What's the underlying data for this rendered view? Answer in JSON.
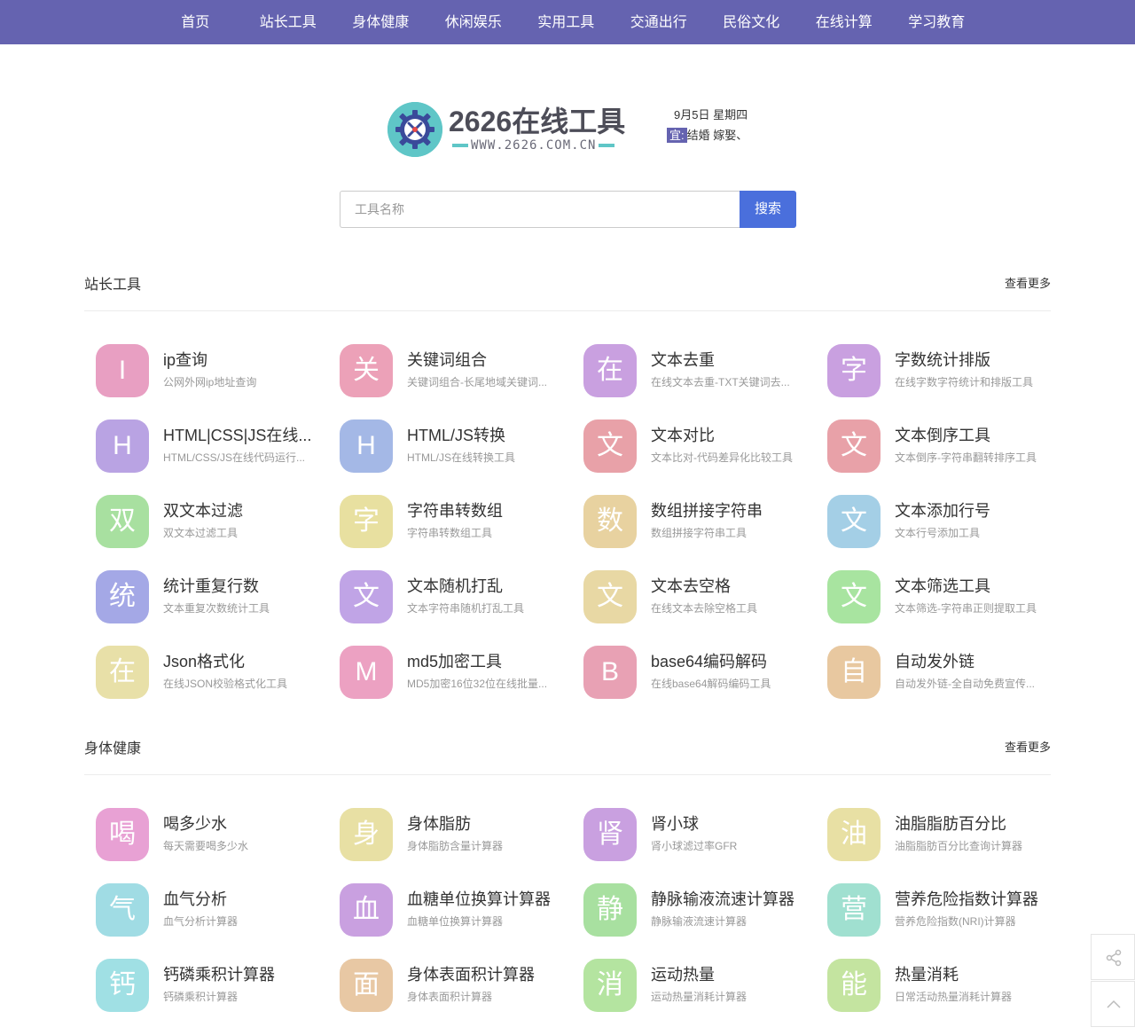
{
  "nav": [
    "首页",
    "站长工具",
    "身体健康",
    "休闲娱乐",
    "实用工具",
    "交通出行",
    "民俗文化",
    "在线计算",
    "学习教育"
  ],
  "logo": {
    "title": "2626在线工具",
    "url": "WWW.2626.COM.CN",
    "icon": "tools-gear-icon",
    "color": "#5fc6c7"
  },
  "date": {
    "text": "9月5日 星期四",
    "yi_label": "宜:",
    "yi_items": "结婚 嫁娶、"
  },
  "search": {
    "placeholder": "工具名称",
    "button": "搜索"
  },
  "colors": {
    "nav": "#6563b0",
    "search_button": "#4a6fdc"
  },
  "sections": [
    {
      "title": "站长工具",
      "more": "查看更多",
      "tools": [
        {
          "badge": "I",
          "name": "ip查询",
          "desc": "公网外网ip地址查询",
          "color": "#e89fc2"
        },
        {
          "badge": "关",
          "name": "关键词组合",
          "desc": "关键词组合-长尾地域关键词...",
          "color": "#eca1b8"
        },
        {
          "badge": "在",
          "name": "文本去重",
          "desc": "在线文本去重-TXT关键词去...",
          "color": "#c9a0e0"
        },
        {
          "badge": "字",
          "name": "字数统计排版",
          "desc": "在线字数字符统计和排版工具",
          "color": "#c9a0e0"
        },
        {
          "badge": "H",
          "name": "HTML|CSS|JS在线...",
          "desc": "HTML/CSS/JS在线代码运行...",
          "color": "#b9a3e3"
        },
        {
          "badge": "H",
          "name": "HTML/JS转换",
          "desc": "HTML/JS在线转换工具",
          "color": "#a4b8e6"
        },
        {
          "badge": "文",
          "name": "文本对比",
          "desc": "文本比对-代码差异化比较工具",
          "color": "#e8a1a8"
        },
        {
          "badge": "文",
          "name": "文本倒序工具",
          "desc": "文本倒序-字符串翻转排序工具",
          "color": "#e8a1a8"
        },
        {
          "badge": "双",
          "name": "双文本过滤",
          "desc": "双文本过滤工具",
          "color": "#a8e0a0"
        },
        {
          "badge": "字",
          "name": "字符串转数组",
          "desc": "字符串转数组工具",
          "color": "#e8e0a0"
        },
        {
          "badge": "数",
          "name": "数组拼接字符串",
          "desc": "数组拼接字符串工具",
          "color": "#e8d2a0"
        },
        {
          "badge": "文",
          "name": "文本添加行号",
          "desc": "文本行号添加工具",
          "color": "#a4cfe6"
        },
        {
          "badge": "统",
          "name": "统计重复行数",
          "desc": "文本重复次数统计工具",
          "color": "#a4a8e6"
        },
        {
          "badge": "文",
          "name": "文本随机打乱",
          "desc": "文本字符串随机打乱工具",
          "color": "#c0a4e6"
        },
        {
          "badge": "文",
          "name": "文本去空格",
          "desc": "在线文本去除空格工具",
          "color": "#e8d8a4"
        },
        {
          "badge": "文",
          "name": "文本筛选工具",
          "desc": "文本筛选-字符串正则提取工具",
          "color": "#a8e4a0"
        },
        {
          "badge": "在",
          "name": "Json格式化",
          "desc": "在线JSON校验格式化工具",
          "color": "#e8e0a8"
        },
        {
          "badge": "M",
          "name": "md5加密工具",
          "desc": "MD5加密16位32位在线批量...",
          "color": "#eca1c2"
        },
        {
          "badge": "B",
          "name": "base64编码解码",
          "desc": "在线base64解码编码工具",
          "color": "#e8a1b4"
        },
        {
          "badge": "自",
          "name": "自动发外链",
          "desc": "自动发外链-全自动免费宣传...",
          "color": "#e8c8a0"
        }
      ]
    },
    {
      "title": "身体健康",
      "more": "查看更多",
      "tools": [
        {
          "badge": "喝",
          "name": "喝多少水",
          "desc": "每天需要喝多少水",
          "color": "#e8a1d4"
        },
        {
          "badge": "身",
          "name": "身体脂肪",
          "desc": "身体脂肪含量计算器",
          "color": "#e8e0a4"
        },
        {
          "badge": "肾",
          "name": "肾小球",
          "desc": "肾小球滤过率GFR",
          "color": "#c9a0e0"
        },
        {
          "badge": "油",
          "name": "油脂脂肪百分比",
          "desc": "油脂脂肪百分比查询计算器",
          "color": "#e8e0a4"
        },
        {
          "badge": "气",
          "name": "血气分析",
          "desc": "血气分析计算器",
          "color": "#a0dce4"
        },
        {
          "badge": "血",
          "name": "血糖单位换算计算器",
          "desc": "血糖单位换算计算器",
          "color": "#c9a0e0"
        },
        {
          "badge": "静",
          "name": "静脉输液流速计算器",
          "desc": "静脉输液流速计算器",
          "color": "#a8e0a0"
        },
        {
          "badge": "营",
          "name": "营养危险指数计算器",
          "desc": "营养危险指数(NRI)计算器",
          "color": "#a0e0d0"
        },
        {
          "badge": "钙",
          "name": "钙磷乘积计算器",
          "desc": "钙磷乘积计算器",
          "color": "#a0e0e4"
        },
        {
          "badge": "面",
          "name": "身体表面积计算器",
          "desc": "身体表面积计算器",
          "color": "#e8c8a4"
        },
        {
          "badge": "消",
          "name": "运动热量",
          "desc": "运动热量消耗计算器",
          "color": "#b4e4a0"
        },
        {
          "badge": "能",
          "name": "热量消耗",
          "desc": "日常活动热量消耗计算器",
          "color": "#c4e4a0"
        }
      ]
    }
  ],
  "float_buttons": [
    {
      "icon": "share-icon"
    },
    {
      "icon": "back-to-top-icon"
    }
  ]
}
